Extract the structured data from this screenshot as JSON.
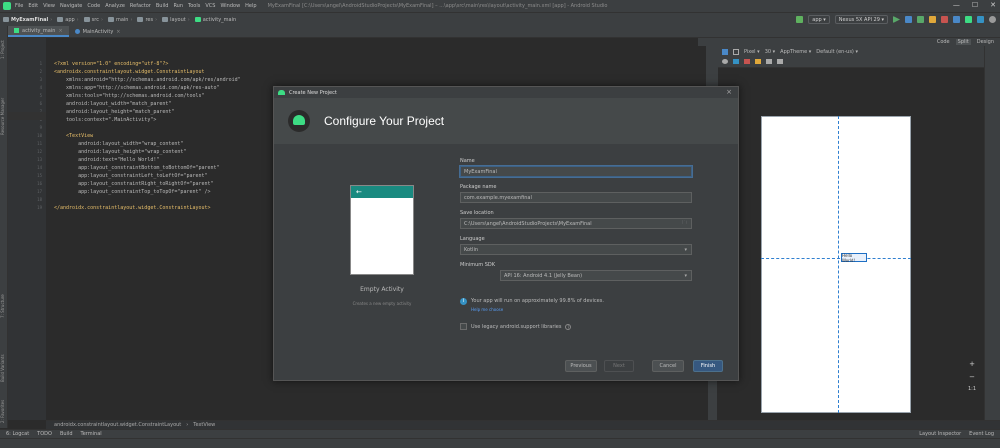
{
  "menubar": {
    "items": [
      "File",
      "Edit",
      "View",
      "Navigate",
      "Code",
      "Analyze",
      "Refactor",
      "Build",
      "Run",
      "Tools",
      "VCS",
      "Window",
      "Help"
    ],
    "path": "MyExamFinal [C:\\Users\\angel\\AndroidStudioProjects\\MyExamFinal] – ...\\app\\src\\main\\res\\layout\\activity_main.xml [app] - Android Studio",
    "window_controls": [
      "—",
      "☐",
      "✕"
    ]
  },
  "navbar": {
    "crumbs": [
      "MyExamFinal",
      "app",
      "src",
      "main",
      "res",
      "layout",
      "activity_main"
    ],
    "module_combo": "app",
    "device_combo": "Nexus 5X API 29"
  },
  "tabs": [
    {
      "label": "activity_main",
      "active": true
    },
    {
      "label": "MainActivity",
      "active": false
    }
  ],
  "leftstrip": {
    "project": "1: Project",
    "resource_manager": "Resource Manager",
    "structure": "7: Structure",
    "build_variants": "Build Variants",
    "favorites": "2: Favorites"
  },
  "editor": {
    "lines": [
      {
        "n": "1",
        "text": "<?xml version=\"1.0\" encoding=\"utf-8\"?>"
      },
      {
        "n": "2",
        "text": "<androidx.constraintlayout.widget.ConstraintLayout"
      },
      {
        "n": "3",
        "text": "    xmlns:android=\"http://schemas.android.com/apk/res/android\""
      },
      {
        "n": "4",
        "text": "    xmlns:app=\"http://schemas.android.com/apk/res-auto\""
      },
      {
        "n": "5",
        "text": "    xmlns:tools=\"http://schemas.android.com/tools\""
      },
      {
        "n": "6",
        "text": "    android:layout_width=\"match_parent\""
      },
      {
        "n": "7",
        "text": "    android:layout_height=\"match_parent\""
      },
      {
        "n": "8",
        "text": "    tools:context=\".MainActivity\">"
      },
      {
        "n": "9",
        "text": ""
      },
      {
        "n": "10",
        "text": "    <TextView"
      },
      {
        "n": "11",
        "text": "        android:layout_width=\"wrap_content\""
      },
      {
        "n": "12",
        "text": "        android:layout_height=\"wrap_content\""
      },
      {
        "n": "13",
        "text": "        android:text=\"Hello World!\""
      },
      {
        "n": "14",
        "text": "        app:layout_constraintBottom_toBottomOf=\"parent\""
      },
      {
        "n": "15",
        "text": "        app:layout_constraintLeft_toLeftOf=\"parent\""
      },
      {
        "n": "16",
        "text": "        app:layout_constraintRight_toRightOf=\"parent\""
      },
      {
        "n": "17",
        "text": "        app:layout_constraintTop_toTopOf=\"parent\" />"
      },
      {
        "n": "18",
        "text": ""
      },
      {
        "n": "19",
        "text": "</androidx.constraintlayout.widget.ConstraintLayout>"
      }
    ]
  },
  "design": {
    "modes": [
      "Code",
      "Split",
      "Design"
    ],
    "device": "Pixel",
    "api": "30",
    "theme": "AppTheme",
    "locale": "Default (en-us)",
    "textview_label": "Hello World!",
    "zoom_controls": [
      "+",
      "−",
      "1:1"
    ]
  },
  "breadcrumb": [
    "androidx.constraintlayout.widget.ConstraintLayout",
    "TextView"
  ],
  "toolwindows": {
    "left": [
      "6: Logcat",
      "TODO",
      "Build",
      "Terminal"
    ],
    "right": [
      "Layout Inspector",
      "Event Log"
    ]
  },
  "dialog": {
    "window_title": "Create New Project",
    "header_title": "Configure Your Project",
    "template_appbar_arrow": "←",
    "template_name": "Empty Activity",
    "template_desc": "Creates a new empty activity",
    "name_label": "Name",
    "name_value": "MyExamFinal",
    "package_label": "Package name",
    "package_value": "com.example.myexamfinal",
    "save_label": "Save location",
    "save_value": "C:\\Users\\angel\\AndroidStudioProjects\\MyExamFinal",
    "language_label": "Language",
    "language_value": "Kotlin",
    "minsdk_label": "Minimum SDK",
    "minsdk_value": "API 16: Android 4.1 (Jelly Bean)",
    "info_text": "Your app will run on approximately 99.8% of devices.",
    "help_link": "Help me choose",
    "legacy_label": "Use legacy android.support libraries",
    "buttons": {
      "previous": "Previous",
      "next": "Next",
      "cancel": "Cancel",
      "finish": "Finish"
    }
  },
  "colors": {
    "accent": "#365880",
    "android_green": "#3ddc84",
    "appbar_teal": "#1a8a80",
    "constraint_blue": "#2f7fd0"
  }
}
